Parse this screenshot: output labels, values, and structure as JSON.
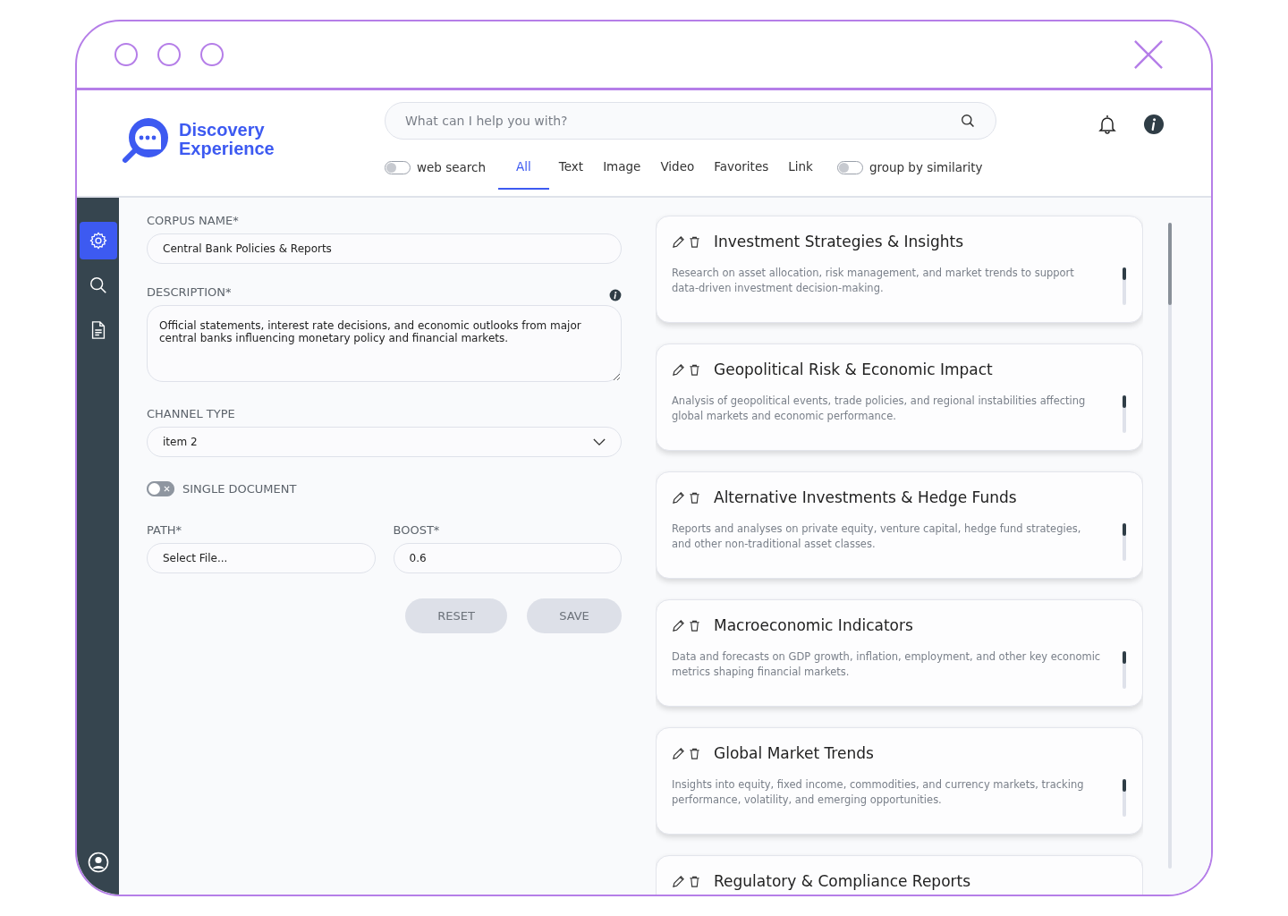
{
  "brand": {
    "line1": "Discovery",
    "line2": "Experience"
  },
  "search": {
    "placeholder": "What can I help you with?"
  },
  "filters": {
    "web_search": {
      "label": "web search",
      "on": false
    },
    "tabs": [
      {
        "label": "All",
        "selected": true
      },
      {
        "label": "Text",
        "selected": false
      },
      {
        "label": "Image",
        "selected": false
      },
      {
        "label": "Video",
        "selected": false
      },
      {
        "label": "Favorites",
        "selected": false
      },
      {
        "label": "Link",
        "selected": false
      }
    ],
    "group_by_similarity": {
      "label": "group by similarity",
      "on": false
    }
  },
  "sidebar": {
    "items": [
      {
        "kind": "settings",
        "selected": true
      },
      {
        "kind": "search",
        "selected": false
      },
      {
        "kind": "document",
        "selected": false
      }
    ]
  },
  "form": {
    "corpus_name": {
      "label": "CORPUS NAME*",
      "value": "Central Bank Policies & Reports"
    },
    "description": {
      "label": "DESCRIPTION*",
      "value": "Official statements, interest rate decisions, and economic outlooks from major central banks influencing monetary policy and financial markets."
    },
    "channel_type": {
      "label": "CHANNEL TYPE",
      "value": "item 2"
    },
    "single_document": {
      "label": "SINGLE DOCUMENT",
      "on": false
    },
    "path": {
      "label": "PATH*",
      "placeholder": "Select File..."
    },
    "boost": {
      "label": "BOOST*",
      "value": "0.6"
    },
    "buttons": [
      {
        "label": "RESET",
        "disabled": true
      },
      {
        "label": "SAVE",
        "disabled": true
      }
    ]
  },
  "corpora": [
    {
      "title": "Investment Strategies & Insights",
      "description": "Research on asset allocation, risk management, and market trends to support data-driven investment decision-making."
    },
    {
      "title": "Geopolitical Risk & Economic Impact",
      "description": "Analysis of geopolitical events, trade policies, and regional instabilities affecting global markets and economic performance."
    },
    {
      "title": "Alternative Investments & Hedge Funds",
      "description": "Reports and analyses on private equity, venture capital, hedge fund strategies, and other non-traditional asset classes."
    },
    {
      "title": "Macroeconomic Indicators",
      "description": "Data and forecasts on GDP growth, inflation, employment, and other key economic metrics shaping financial markets."
    },
    {
      "title": "Global Market Trends",
      "description": "Insights into equity, fixed income, commodities, and currency markets, tracking performance, volatility, and emerging opportunities."
    },
    {
      "title": "Regulatory & Compliance Reports"
    }
  ]
}
